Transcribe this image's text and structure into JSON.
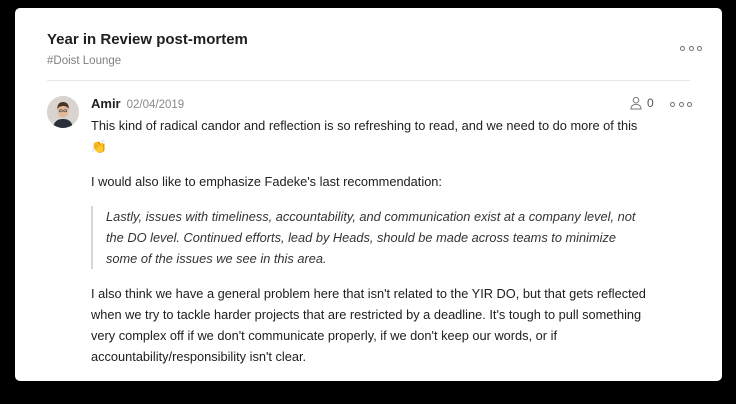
{
  "thread": {
    "title": "Year in Review post-mortem",
    "channel": "#Doist Lounge"
  },
  "comment": {
    "author": "Amir",
    "date": "02/04/2019",
    "reaction_count": "0",
    "paragraph1": "This kind of radical candor and reflection is so refreshing to read, and we need to do more of this 👏",
    "paragraph2": "I would also like to emphasize Fadeke's last recommendation:",
    "quote": "Lastly, issues with timeliness, accountability, and communication exist at a company level, not the DO level. Continued efforts, lead by Heads, should be made across teams to minimize some of the issues we see in this area.",
    "paragraph3": "I also think we have a general problem here that isn't related to the YIR DO, but that gets reflected when we try to tackle harder projects that are restricted by a deadline. It's tough to pull something very complex off if we don't communicate properly, if we don't keep our words, or if accountability/responsibility isn't clear."
  },
  "icons": {
    "thread_more": "more-horizontal-icon",
    "comment_more": "more-horizontal-icon",
    "reaction": "person-icon"
  }
}
